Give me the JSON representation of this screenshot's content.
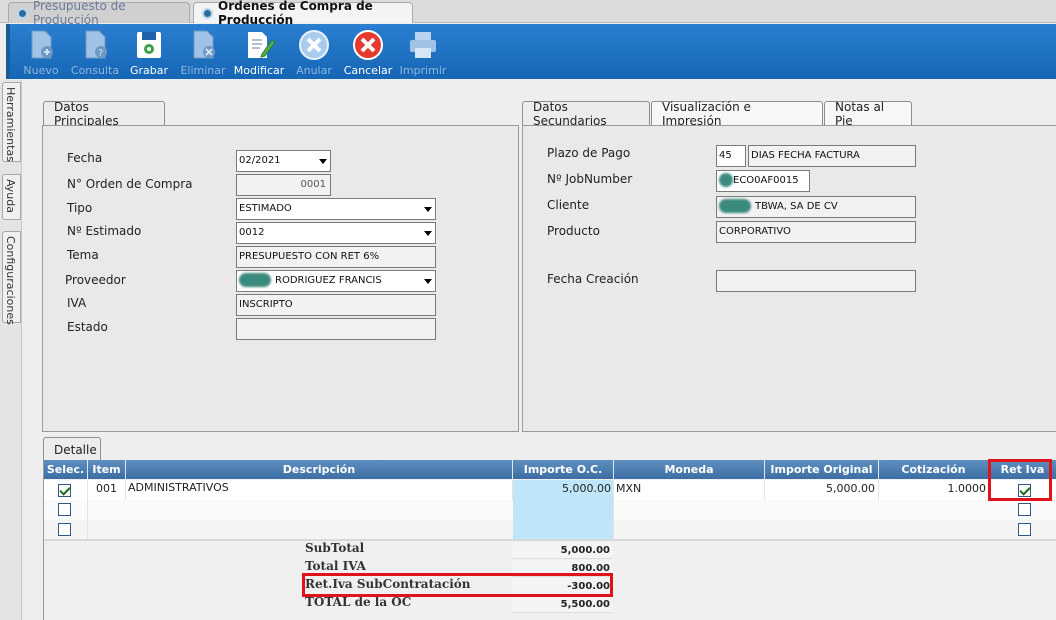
{
  "window_tabs": [
    {
      "label": "Presupuesto de Producción"
    },
    {
      "label": "Ordenes de Compra de Producción"
    }
  ],
  "toolbar": {
    "nuevo": "Nuevo",
    "consulta": "Consulta",
    "grabar": "Grabar",
    "eliminar": "Eliminar",
    "modificar": "Modificar",
    "anular": "Anular",
    "cancelar": "Cancelar",
    "imprimir": "Imprimir"
  },
  "side_tabs": {
    "herramientas": "Herramientas",
    "ayuda": "Ayuda",
    "configuraciones": "Configuraciones"
  },
  "principal": {
    "tab": "Datos Principales",
    "fecha_label": "Fecha",
    "fecha_value": "02/2021",
    "orden_label": "N° Orden de Compra",
    "orden_value": "0001",
    "tipo_label": "Tipo",
    "tipo_value": "ESTIMADO",
    "estimado_label": "Nº Estimado",
    "estimado_value": "0012",
    "tema_label": "Tema",
    "tema_value": "PRESUPUESTO CON RET 6%",
    "proveedor_label": "Proveedor",
    "proveedor_value": "RODRIGUEZ FRANCIS",
    "iva_label": "IVA",
    "iva_value": "INSCRIPTO",
    "estado_label": "Estado",
    "estado_value": ""
  },
  "secundarios": {
    "tab1": "Datos Secundarios",
    "tab2": "Visualización e Impresión",
    "tab3": "Notas al Pie",
    "plazo_label": "Plazo de Pago",
    "plazo_days": "45",
    "plazo_desc": "DIAS FECHA FACTURA",
    "job_label": "Nº JobNumber",
    "job_value": "ECO0AF0015",
    "cliente_label": "Cliente",
    "cliente_value": "TBWA, SA DE CV",
    "producto_label": "Producto",
    "producto_value": "CORPORATIVO",
    "fecha_creacion_label": "Fecha Creación",
    "fecha_creacion_value": ""
  },
  "detalle": {
    "tab": "Detalle",
    "columns": {
      "selec": "Selec.",
      "item": "Item",
      "descripcion": "Descripción",
      "importe": "Importe O.C.",
      "moneda": "Moneda",
      "importe_original": "Importe Original",
      "cotizacion": "Cotización",
      "ret_iva": "Ret Iva"
    },
    "rows": [
      {
        "item": "001",
        "descripcion": "ADMINISTRATIVOS",
        "importe": "5,000.00",
        "moneda": "MXN",
        "importe_original": "5,000.00",
        "cotizacion": "1.0000"
      }
    ]
  },
  "totals": {
    "subtotal_label": "SubTotal",
    "subtotal_value": "5,000.00",
    "total_iva_label": "Total IVA",
    "total_iva_value": "800.00",
    "ret_iva_label": "Ret.Iva SubContratación",
    "ret_iva_value": "-300.00",
    "total_oc_label": "TOTAL de la OC",
    "total_oc_value": "5,500.00"
  },
  "colors": {
    "toolbar": "#1f72c4",
    "highlight_border": "#e0121a",
    "header": "#4a7bb0",
    "importe_bg": "#bfe6f8"
  }
}
